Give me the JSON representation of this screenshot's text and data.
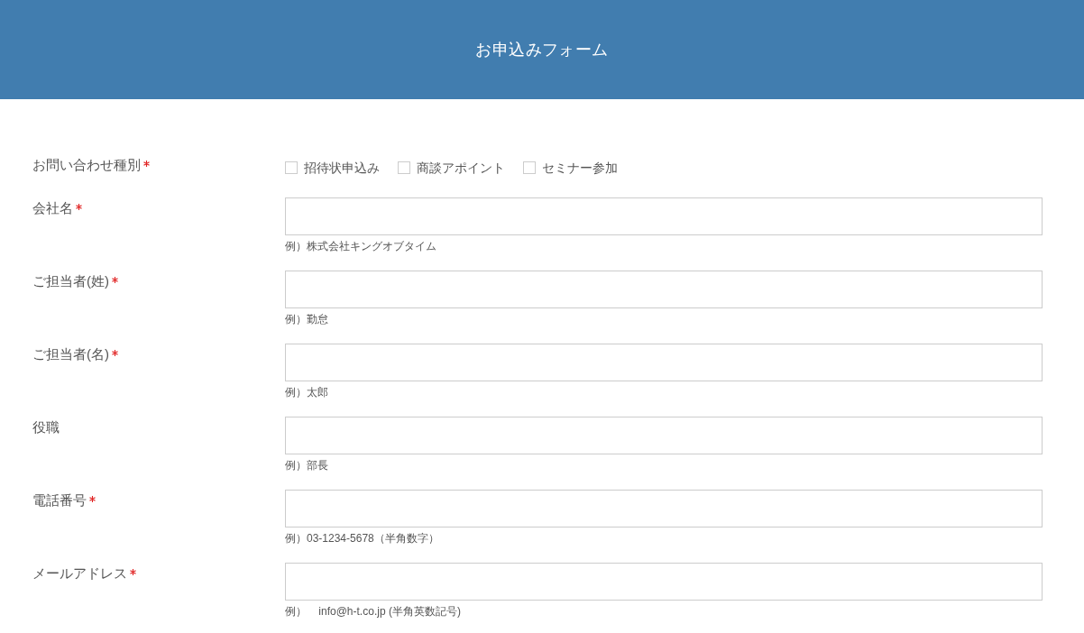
{
  "header": {
    "title": "お申込みフォーム"
  },
  "inquiry_type": {
    "label": "お問い合わせ種別",
    "required": true,
    "options": [
      {
        "label": "招待状申込み",
        "checked": false
      },
      {
        "label": "商談アポイント",
        "checked": false
      },
      {
        "label": "セミナー参加",
        "checked": false
      }
    ]
  },
  "fields": [
    {
      "label": "会社名",
      "required": true,
      "hint": "例）株式会社キングオブタイム"
    },
    {
      "label": "ご担当者(姓)",
      "required": true,
      "hint": "例）勤怠"
    },
    {
      "label": "ご担当者(名)",
      "required": true,
      "hint": "例）太郎"
    },
    {
      "label": "役職",
      "required": false,
      "hint": "例）部長"
    },
    {
      "label": "電話番号",
      "required": true,
      "hint": "例）03-1234-5678（半角数字）"
    },
    {
      "label": "メールアドレス",
      "required": true,
      "hint": "例）    info@h-t.co.jp (半角英数記号)"
    }
  ]
}
